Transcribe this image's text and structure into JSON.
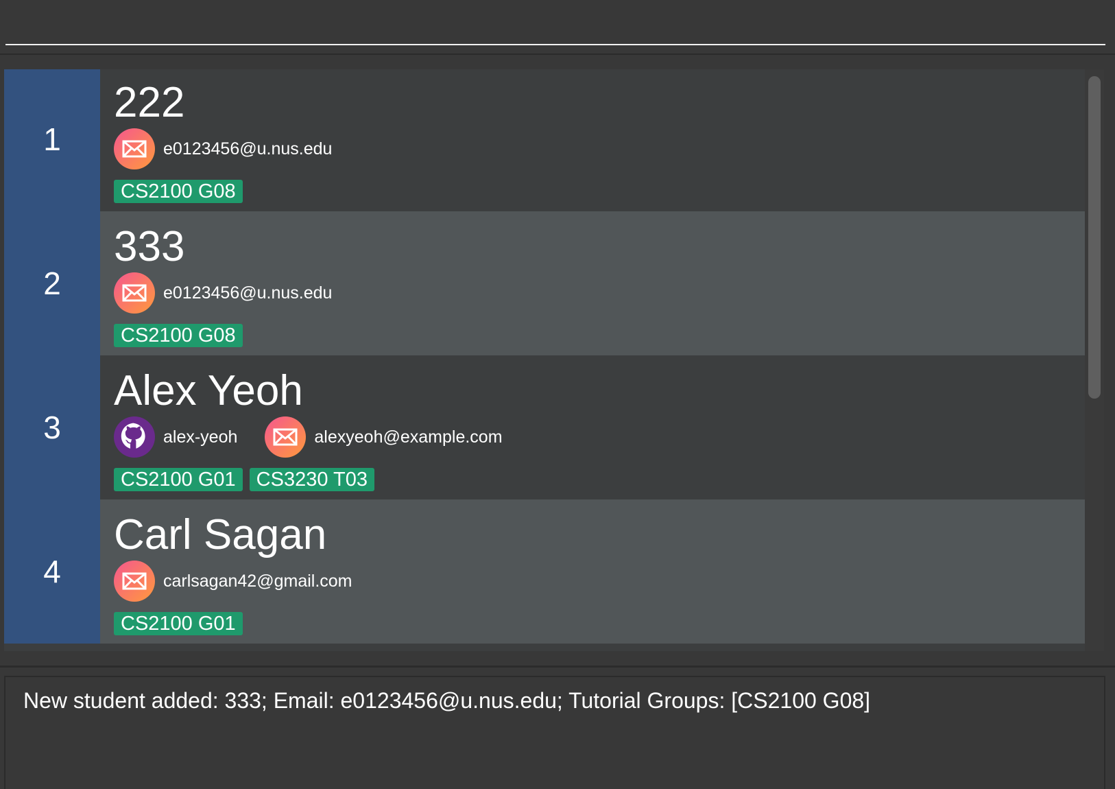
{
  "command_box": {
    "value": "",
    "placeholder": ""
  },
  "students": [
    {
      "index": "1",
      "name": "222",
      "github": null,
      "email": "e0123456@u.nus.edu",
      "tags": [
        "CS2100 G08"
      ]
    },
    {
      "index": "2",
      "name": "333",
      "github": null,
      "email": "e0123456@u.nus.edu",
      "tags": [
        "CS2100 G08"
      ]
    },
    {
      "index": "3",
      "name": "Alex Yeoh",
      "github": "alex-yeoh",
      "email": "alexyeoh@example.com",
      "tags": [
        "CS2100 G01",
        "CS3230 T03"
      ]
    },
    {
      "index": "4",
      "name": "Carl Sagan",
      "github": null,
      "email": "carlsagan42@gmail.com",
      "tags": [
        "CS2100 G01"
      ]
    }
  ],
  "result_display": {
    "text": "New student added: 333; Email: e0123456@u.nus.edu; Tutorial Groups: [CS2100 G08]"
  },
  "colors": {
    "index_bg": "#33527f",
    "tag_bg": "#1f9a6c",
    "card_odd": "#3c3e3f",
    "card_even": "#515658"
  },
  "icons": {
    "email": "envelope-icon",
    "github": "github-icon"
  }
}
